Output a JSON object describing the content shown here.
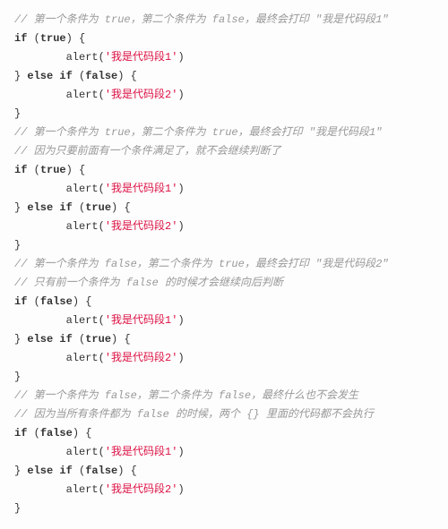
{
  "code": {
    "block1": {
      "comment1": "// 第一个条件为 true，第二个条件为 false，最终会打印 \"我是代码段1\"",
      "if_kw": "if",
      "cond1": "true",
      "alert_fn": "alert",
      "str1": "'我是代码段1'",
      "else_kw": "else",
      "if2_kw": "if",
      "cond2": "false",
      "str2": "'我是代码段2'"
    },
    "block2": {
      "comment1": "// 第一个条件为 true，第二个条件为 true，最终会打印 \"我是代码段1\"",
      "comment2": "// 因为只要前面有一个条件满足了，就不会继续判断了",
      "if_kw": "if",
      "cond1": "true",
      "alert_fn": "alert",
      "str1": "'我是代码段1'",
      "else_kw": "else",
      "if2_kw": "if",
      "cond2": "true",
      "str2": "'我是代码段2'"
    },
    "block3": {
      "comment1": "// 第一个条件为 false，第二个条件为 true，最终会打印 \"我是代码段2\"",
      "comment2": "// 只有前一个条件为 false 的时候才会继续向后判断",
      "if_kw": "if",
      "cond1": "false",
      "alert_fn": "alert",
      "str1": "'我是代码段1'",
      "else_kw": "else",
      "if2_kw": "if",
      "cond2": "true",
      "str2": "'我是代码段2'"
    },
    "block4": {
      "comment1": "// 第一个条件为 false，第二个条件为 false，最终什么也不会发生",
      "comment2": "// 因为当所有条件都为 false 的时候，两个 {} 里面的代码都不会执行",
      "if_kw": "if",
      "cond1": "false",
      "alert_fn": "alert",
      "str1": "'我是代码段1'",
      "else_kw": "else",
      "if2_kw": "if",
      "cond2": "false",
      "str2": "'我是代码段2'"
    }
  }
}
